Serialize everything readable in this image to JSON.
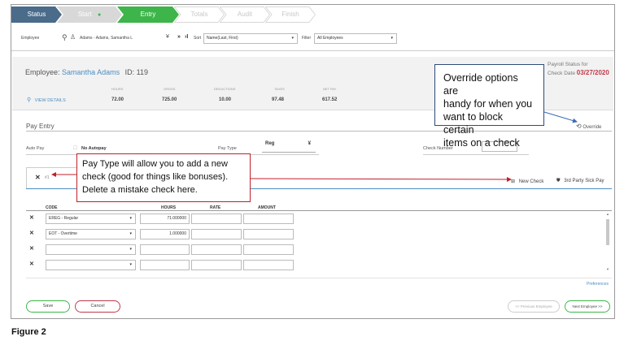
{
  "steps": [
    {
      "label": "Status"
    },
    {
      "label": "Start"
    },
    {
      "label": "Entry"
    },
    {
      "label": "Totals"
    },
    {
      "label": "Audit"
    },
    {
      "label": "Finish"
    }
  ],
  "employee_bar": {
    "employee_label": "Employee",
    "employee_value": "Adams - Adams, Samantha L",
    "sort_label": "Sort",
    "sort_value": "Name(Last, First)",
    "filter_label": "Filter",
    "filter_value": "All Employees"
  },
  "summary": {
    "employee_prefix": "Employee:",
    "employee_name": "Samantha Adams",
    "id_text": "ID: 119",
    "view_details": "VIEW DETAILS",
    "stats": [
      {
        "label": "HOURS",
        "value": "72.00"
      },
      {
        "label": "GROSS",
        "value": "725.00"
      },
      {
        "label": "DEDUCTIONS",
        "value": "10.00"
      },
      {
        "label": "TAXES",
        "value": "97.48"
      },
      {
        "label": "NET PAY",
        "value": "617.52"
      }
    ],
    "payroll_status_line1": "Payroll Status for",
    "payroll_status_line2": "Check Date",
    "check_date": "03/27/2020"
  },
  "pay_entry": {
    "title": "Pay Entry",
    "override": "Override",
    "auto_pay_label": "Auto Pay",
    "auto_pay_value": "No Autopay",
    "pay_type_label": "Pay Type",
    "pay_type_value": "Reg",
    "check_number_label": "Check Number",
    "check_number_value": "",
    "new_check": "New Check",
    "third_party": "3rd Party Sick Pay",
    "tab_label": "#1"
  },
  "table": {
    "headers": [
      "CODE",
      "HOURS",
      "RATE",
      "AMOUNT"
    ],
    "rows": [
      {
        "code": "EREG - Regular",
        "hours": "71.000000"
      },
      {
        "code": "EOT - Overtime",
        "hours": "1.000000"
      },
      {
        "code": "",
        "hours": ""
      },
      {
        "code": "",
        "hours": ""
      }
    ]
  },
  "footer": {
    "preferences": "Preferences",
    "save": "Save",
    "cancel": "Cancel",
    "previous": "<< Previous Employee",
    "next": "Next Employee >>"
  },
  "callouts": {
    "override": [
      "Override options are",
      "handy for when you",
      "want to block certain",
      "items on a check"
    ],
    "pay_type": [
      "Pay Type will allow you to add a new",
      "check (good for things like bonuses).",
      "Delete a mistake check here."
    ]
  },
  "caption": "Figure 2",
  "colors": {
    "step_done": "#4a6b8a",
    "step_active": "#3db54a",
    "callout_blue": "#2e4a7a",
    "callout_red": "#c0202a",
    "accent_blue": "#4a8ec2",
    "date_red": "#c0394b"
  }
}
